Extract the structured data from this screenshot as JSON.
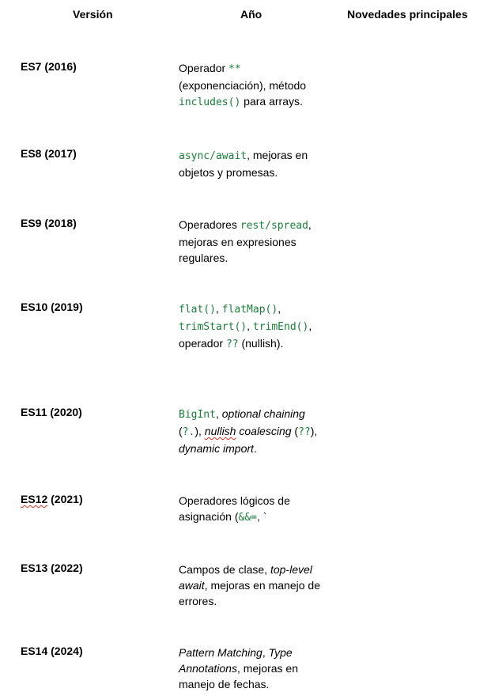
{
  "table": {
    "headers": {
      "version": "Versión",
      "year": "Año",
      "news": "Novedades principales"
    },
    "rows": [
      {
        "version": "ES7 (2016)",
        "desc": {
          "t1": "Operador ",
          "c1": "**",
          "t2": " (exponenciación), método ",
          "c2": "includes()",
          "t3": " para arrays."
        }
      },
      {
        "version": "ES8 (2017)",
        "desc": {
          "c1": "async/await",
          "t1": ", mejoras en objetos y promesas."
        }
      },
      {
        "version": "ES9 (2018)",
        "desc": {
          "t1": "Operadores ",
          "c1": "rest/spread",
          "t2": ", mejoras en expresiones regulares."
        }
      },
      {
        "version": "ES10 (2019)",
        "desc": {
          "c1": "flat()",
          "t1": ", ",
          "c2": "flatMap()",
          "t2": ", ",
          "c3": "trimStart()",
          "t3": ", ",
          "c4": "trimEnd()",
          "t4": ", operador ",
          "c5": "??",
          "t5": " (nullish)."
        }
      },
      {
        "version": "ES11 (2020)",
        "desc": {
          "c1": "BigInt",
          "t1": ", ",
          "e1": "optional chaining",
          "t2": " (",
          "c2": "?.",
          "t3": "), ",
          "e2": "nullish",
          "e3": " coalescing",
          "t4": " (",
          "c3": "??",
          "t5": "), ",
          "e4": "dynamic import",
          "t6": "."
        }
      },
      {
        "version_a": "ES12",
        "version_b": " (2021)",
        "desc": {
          "t1": "Operadores lógicos de asignación (",
          "c1": "&&=",
          "t2": ", `"
        }
      },
      {
        "version": "ES13 (2022)",
        "desc": {
          "t1": "Campos de clase, ",
          "e1": "top-level await",
          "t2": ", mejoras en manejo de errores."
        }
      },
      {
        "version": "ES14 (2024)",
        "desc": {
          "e1": "Pattern Matching",
          "t1": ", ",
          "e2": "Type Annotations",
          "t2": ", mejoras en manejo de fechas."
        }
      }
    ]
  }
}
